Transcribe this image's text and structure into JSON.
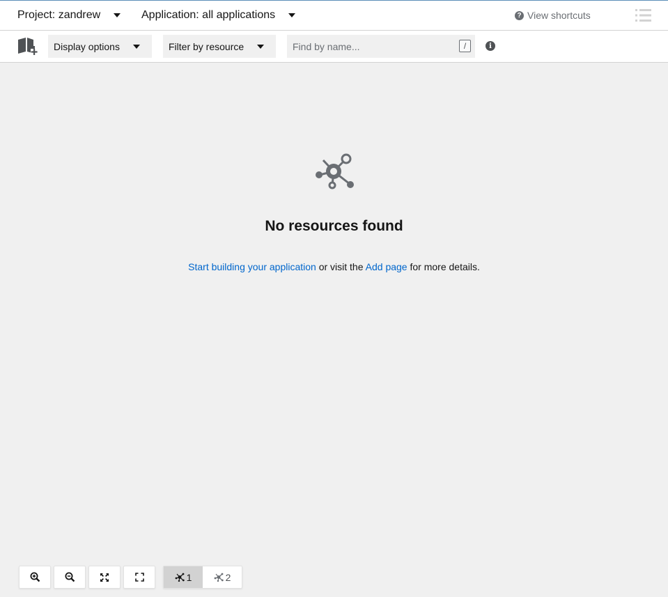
{
  "header": {
    "project_label": "Project: zandrew",
    "application_label": "Application: all applications",
    "shortcuts_label": "View shortcuts",
    "shortcuts_icon_glyph": "?"
  },
  "toolbar": {
    "display_options_label": "Display options",
    "filter_label": "Filter by resource",
    "search_placeholder": "Find by name...",
    "search_value": "",
    "search_shortcut_key": "/",
    "info_glyph": "i"
  },
  "empty_state": {
    "title": "No resources found",
    "link_start": "Start building your application",
    "text_middle": "or visit the",
    "link_add": "Add page",
    "text_end": "for more details."
  },
  "controls": {
    "zoom_in_icon": "zoom-in-icon",
    "zoom_out_icon": "zoom-out-icon",
    "fit_icon": "fit-to-screen-icon",
    "reset_icon": "reset-view-icon",
    "layouts": [
      {
        "label": "1",
        "active": true
      },
      {
        "label": "2",
        "active": false
      }
    ]
  },
  "colors": {
    "link": "#0066cc",
    "icon_gray": "#6a6e73",
    "canvas_bg": "#f0f0f0",
    "top_accent": "#5b8db8"
  }
}
